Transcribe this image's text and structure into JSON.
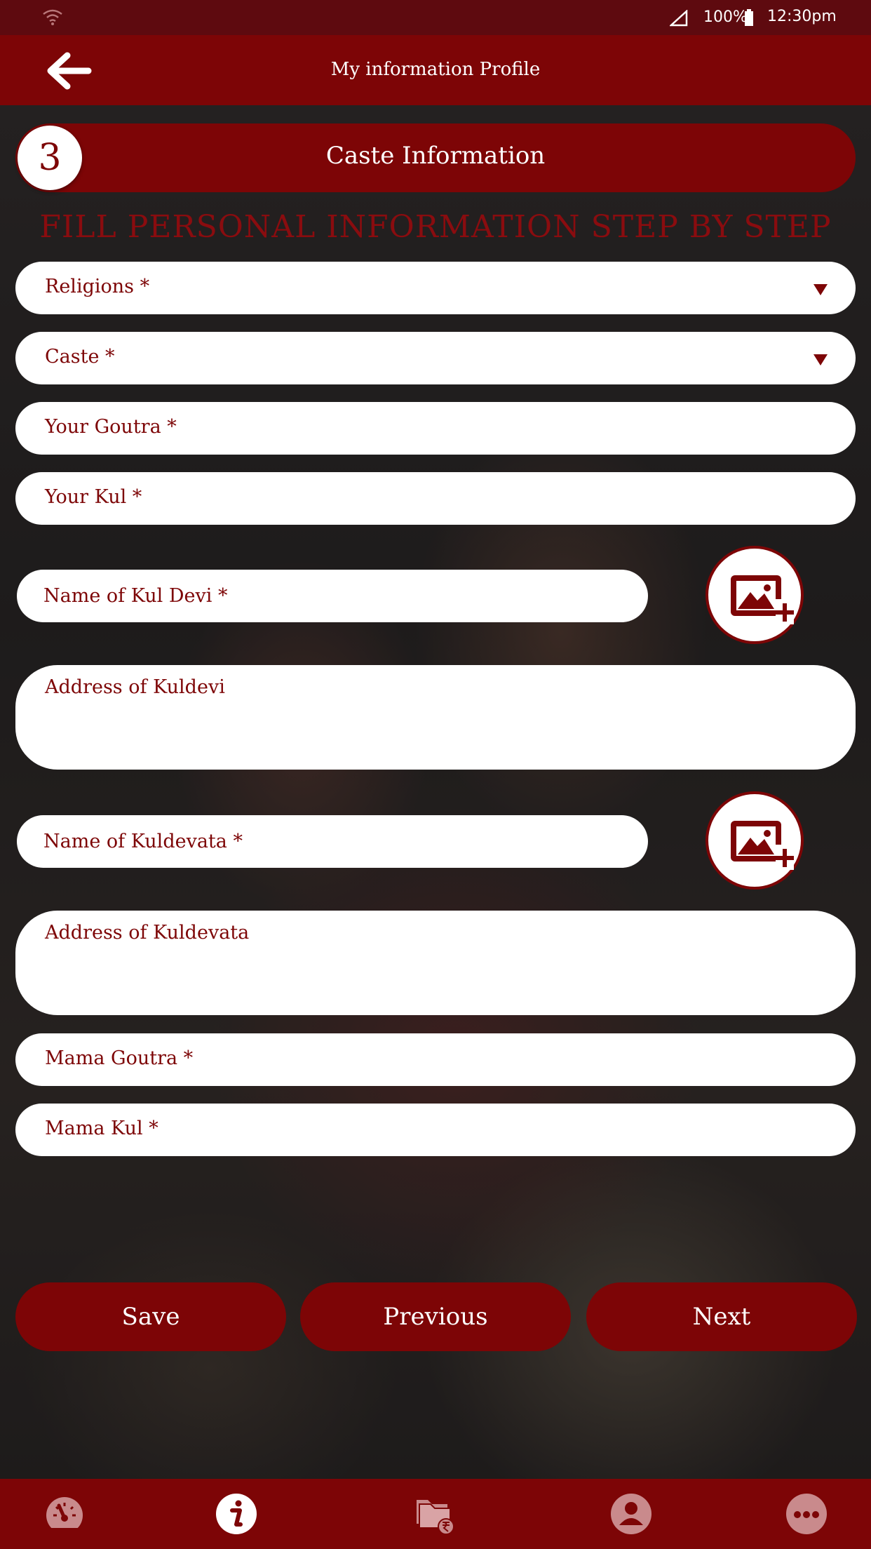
{
  "status_bar": {
    "battery": "100%",
    "time": "12:30pm"
  },
  "header": {
    "title": "My information Profile"
  },
  "step": {
    "number": "3",
    "title": "Caste Information"
  },
  "subtitle": "FILL PERSONAL INFORMATION STEP BY STEP",
  "fields": {
    "religions": {
      "label": "Religions *"
    },
    "caste": {
      "label": "Caste *"
    },
    "goutra": {
      "label": "Your Goutra *"
    },
    "kul": {
      "label": "Your Kul *"
    },
    "kul_devi_name": {
      "label": "Name of Kul Devi  *"
    },
    "kuldevi_address": {
      "label": "Address of Kuldevi"
    },
    "kuldevata_name": {
      "label": "Name of Kuldevata *"
    },
    "kuldevata_address": {
      "label": "Address of Kuldevata"
    },
    "mama_goutra": {
      "label": "Mama Goutra *"
    },
    "mama_kul": {
      "label": "Mama Kul *"
    }
  },
  "buttons": {
    "save": "Save",
    "previous": "Previous",
    "next": "Next"
  },
  "bottom_nav": {
    "items": [
      {
        "icon": "dashboard-icon",
        "active": false
      },
      {
        "icon": "info-icon",
        "active": true
      },
      {
        "icon": "payment-folder-icon",
        "active": false
      },
      {
        "icon": "profile-icon",
        "active": false
      },
      {
        "icon": "more-icon",
        "active": false
      }
    ]
  },
  "colors": {
    "primary": "#7d0506",
    "status_bar": "#5e0a0f",
    "field_bg": "#ffffff"
  }
}
